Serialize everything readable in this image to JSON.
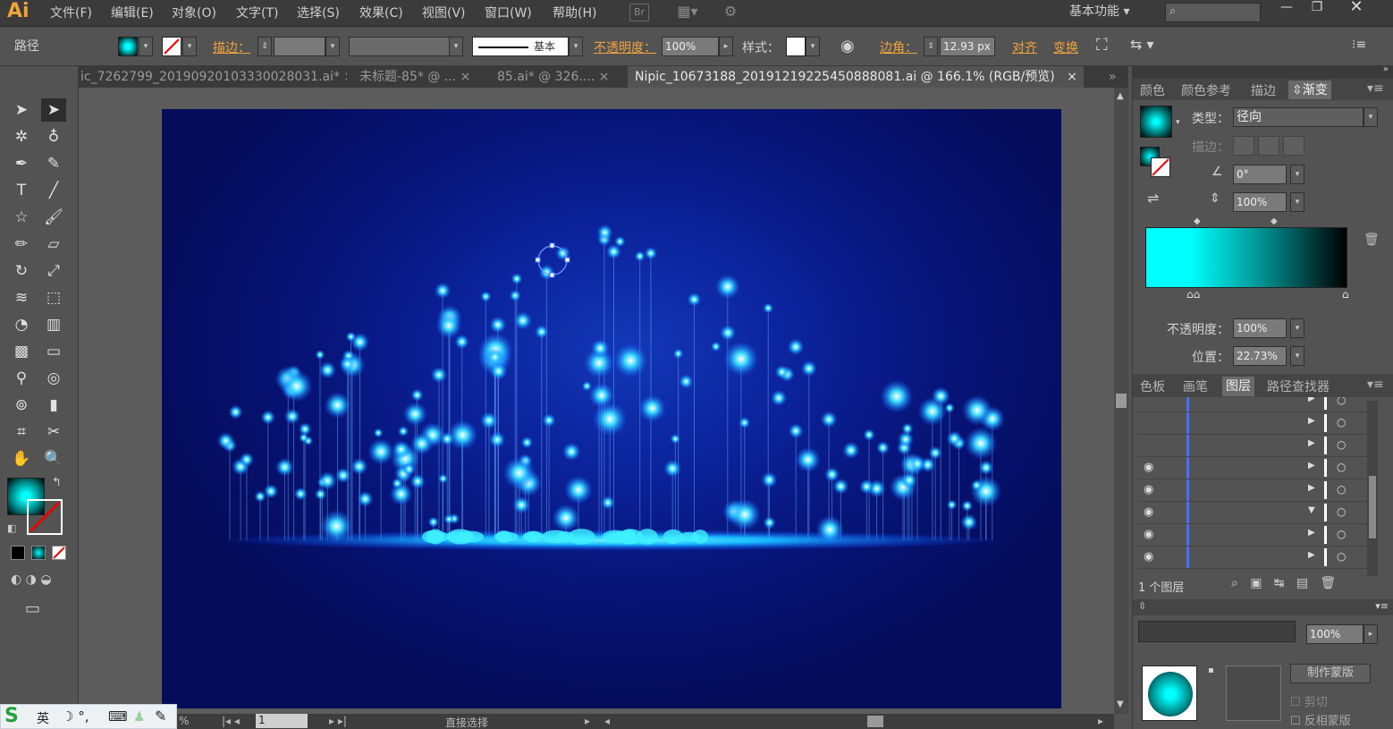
{
  "menubar": {
    "logo": "Ai",
    "items": [
      "文件(F)",
      "编辑(E)",
      "对象(O)",
      "文字(T)",
      "选择(S)",
      "效果(C)",
      "视图(V)",
      "窗口(W)",
      "帮助(H)"
    ],
    "br": "Br",
    "workspace": "基本功能"
  },
  "control": {
    "selection": "路径",
    "stroke_label": "描边：",
    "stroke_profile": "基本",
    "opacity_label": "不透明度：",
    "opacity_value": "100%",
    "style_label": "样式：",
    "corner_label": "边角：",
    "corner_value": "12.93 px",
    "align_label": "对齐",
    "transform_label": "变换"
  },
  "tabs": [
    "ic_7262799_20190920103330028031.ai*",
    "未标题-85* @ ...",
    "85.ai* @ 326....",
    "Nipic_10673188_20191219225450888081.ai @ 166.1% (RGB/预览)"
  ],
  "gradient_panel": {
    "tabs": [
      "颜色",
      "颜色参考",
      "描边",
      "渐变"
    ],
    "type_label": "类型：",
    "type_value": "径向",
    "stroke_label": "描边：",
    "angle_value": "0°",
    "aspect_value": "100%",
    "opacity_label": "不透明度：",
    "opacity_value": "100%",
    "position_label": "位置：",
    "position_value": "22.73%",
    "colors": {
      "start": "#00ffff",
      "end": "#000000"
    }
  },
  "layers_panel": {
    "tabs": [
      "色板",
      "画笔",
      "图层",
      "路径查找器"
    ],
    "footer": "1 个图层"
  },
  "transparency_panel": {
    "opacity": "100%",
    "mask_button": "制作蒙版",
    "clip": "剪切",
    "invert": "反相蒙版"
  },
  "status": {
    "zoom": "%",
    "page": "1",
    "tool": "直接选择"
  },
  "ime": {
    "lang": "英"
  },
  "colors": {
    "accent": "#f0a33a",
    "glow": "#00e5ff",
    "bg_dark": "#050c5a"
  }
}
